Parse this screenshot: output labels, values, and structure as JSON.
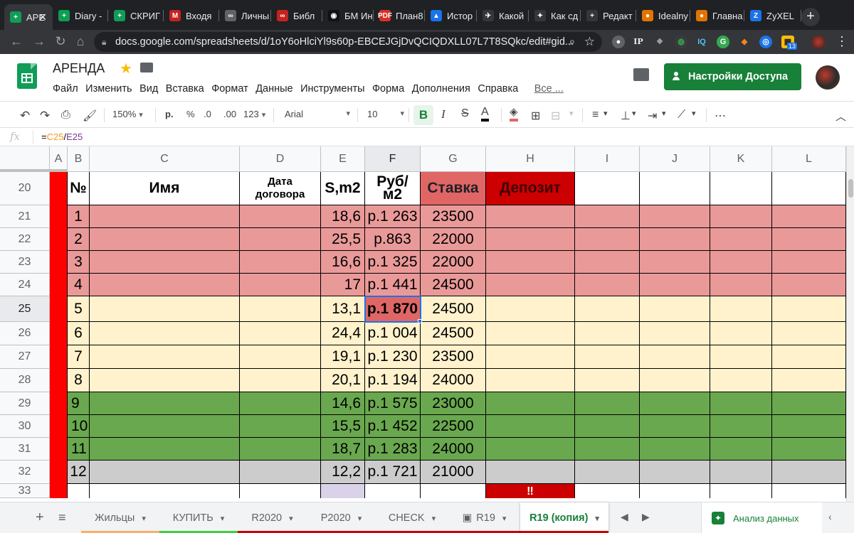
{
  "browser": {
    "tabs": [
      {
        "label": "АРЕ",
        "fav": "+",
        "favcolor": "#0f9d58",
        "active": true
      },
      {
        "label": "Diary -",
        "fav": "+",
        "favcolor": "#0f9d58"
      },
      {
        "label": "СКРИГ",
        "fav": "+",
        "favcolor": "#0f9d58"
      },
      {
        "label": "Входя",
        "fav": "M",
        "favcolor": "#c5221f"
      },
      {
        "label": "Личны",
        "fav": "∞",
        "favcolor": "#5f6368"
      },
      {
        "label": "Библ",
        "fav": "∞",
        "favcolor": "#c5221f"
      },
      {
        "label": "БМ Ин",
        "fav": "◉",
        "favcolor": "#111"
      },
      {
        "label": "План8",
        "fav": "PDF",
        "favcolor": "#d93025"
      },
      {
        "label": "Истор",
        "fav": "▲",
        "favcolor": "#1a73e8"
      },
      {
        "label": "Какой",
        "fav": "✈",
        "favcolor": "#35363a"
      },
      {
        "label": "Как сд",
        "fav": "✦",
        "favcolor": "#35363a"
      },
      {
        "label": "Редакт",
        "fav": "+",
        "favcolor": "#35363a"
      },
      {
        "label": "Idealny",
        "fav": "●",
        "favcolor": "#e37400"
      },
      {
        "label": "Главна",
        "fav": "●",
        "favcolor": "#e37400"
      },
      {
        "label": "ZyXEL",
        "fav": "Z",
        "favcolor": "#1a73e8"
      }
    ],
    "new_tab": "+",
    "url": "docs.google.com/spreadsheets/d/1oY6oHlciYl9s60p-EBCEJGjDvQCIQDXLL07L7T8SQkc/edit#gid...",
    "ext_badge": "13"
  },
  "doc": {
    "title": "АРЕНДА",
    "menu": [
      "Файл",
      "Изменить",
      "Вид",
      "Вставка",
      "Формат",
      "Данные",
      "Инструменты",
      "Форма",
      "Дополнения",
      "Справка"
    ],
    "menu_more": "Все ...",
    "share_label": "Настройки Доступа"
  },
  "toolbar": {
    "zoom": "150%",
    "currency": "р.",
    "percent": "%",
    "dec_less": ".0",
    "dec_more": ".00",
    "format_more": "123",
    "font": "Arial",
    "font_size": "10",
    "bold": "B",
    "italic": "I",
    "strike": "S",
    "text_color": "A",
    "more": "⋯"
  },
  "formula": {
    "fx": "fx",
    "prefix": "=",
    "ref1": "C25",
    "op": "/",
    "ref2": "E25"
  },
  "columns": [
    "A",
    "B",
    "C",
    "D",
    "E",
    "F",
    "G",
    "H",
    "I",
    "J",
    "K",
    "L"
  ],
  "header_row": {
    "row": "20",
    "no": "№",
    "name": "Имя",
    "date": "Дата договора",
    "s": "S,m2",
    "rub": "Руб/м2",
    "rate": "Ставка",
    "deposit": "Депозит"
  },
  "rows": [
    {
      "row": "21",
      "no": "1",
      "s": "18,6",
      "rub": "р.1 263",
      "rate": "23500",
      "color": "#ea9999"
    },
    {
      "row": "22",
      "no": "2",
      "s": "25,5",
      "rub": "р.863",
      "rate": "22000",
      "color": "#ea9999"
    },
    {
      "row": "23",
      "no": "3",
      "s": "16,6",
      "rub": "р.1 325",
      "rate": "22000",
      "color": "#ea9999"
    },
    {
      "row": "24",
      "no": "4",
      "s": "17",
      "rub": "р.1 441",
      "rate": "24500",
      "color": "#ea9999"
    },
    {
      "row": "25",
      "no": "5",
      "s": "13,1",
      "rub": "р.1 870",
      "rate": "24500",
      "color": "#fff2cc",
      "selected": true
    },
    {
      "row": "26",
      "no": "6",
      "s": "24,4",
      "rub": "р.1 004",
      "rate": "24500",
      "color": "#fff2cc"
    },
    {
      "row": "27",
      "no": "7",
      "s": "19,1",
      "rub": "р.1 230",
      "rate": "23500",
      "color": "#fff2cc"
    },
    {
      "row": "28",
      "no": "8",
      "s": "20,1",
      "rub": "р.1 194",
      "rate": "24000",
      "color": "#fff2cc"
    },
    {
      "row": "29",
      "no": "9",
      "s": "14,6",
      "rub": "р.1 575",
      "rate": "23000",
      "color": "#6aa84f"
    },
    {
      "row": "30",
      "no": "10",
      "s": "15,5",
      "rub": "р.1 452",
      "rate": "22500",
      "color": "#6aa84f"
    },
    {
      "row": "31",
      "no": "11",
      "s": "18,7",
      "rub": "р.1 283",
      "rate": "24000",
      "color": "#6aa84f"
    },
    {
      "row": "32",
      "no": "12",
      "s": "12,2",
      "rub": "р.1 721",
      "rate": "21000",
      "color": "#cccccc"
    }
  ],
  "partial_row": {
    "row": "33",
    "deposit": "‼"
  },
  "colors": {
    "col_a_red": "#ff0000",
    "rate_header": "#e06666",
    "deposit_header": "#cc0000",
    "selected_cell": "#e06666",
    "partial_e": "#d9d2e9"
  },
  "sheet_tabs": [
    {
      "label": "Жильцы",
      "bar": "#f6b26b"
    },
    {
      "label": "КУПИТЬ",
      "bar": "#3dd13d"
    },
    {
      "label": "R2020",
      "bar": "#cc0000"
    },
    {
      "label": "P2020",
      "bar": "#cc0000"
    },
    {
      "label": "CHECK",
      "bar": "#cc0000"
    },
    {
      "label": "R19",
      "bar": "#cc0000"
    },
    {
      "label": "R19 (копия)",
      "bar": "#cc0000",
      "active": true
    }
  ],
  "explore_label": "Анализ данных"
}
